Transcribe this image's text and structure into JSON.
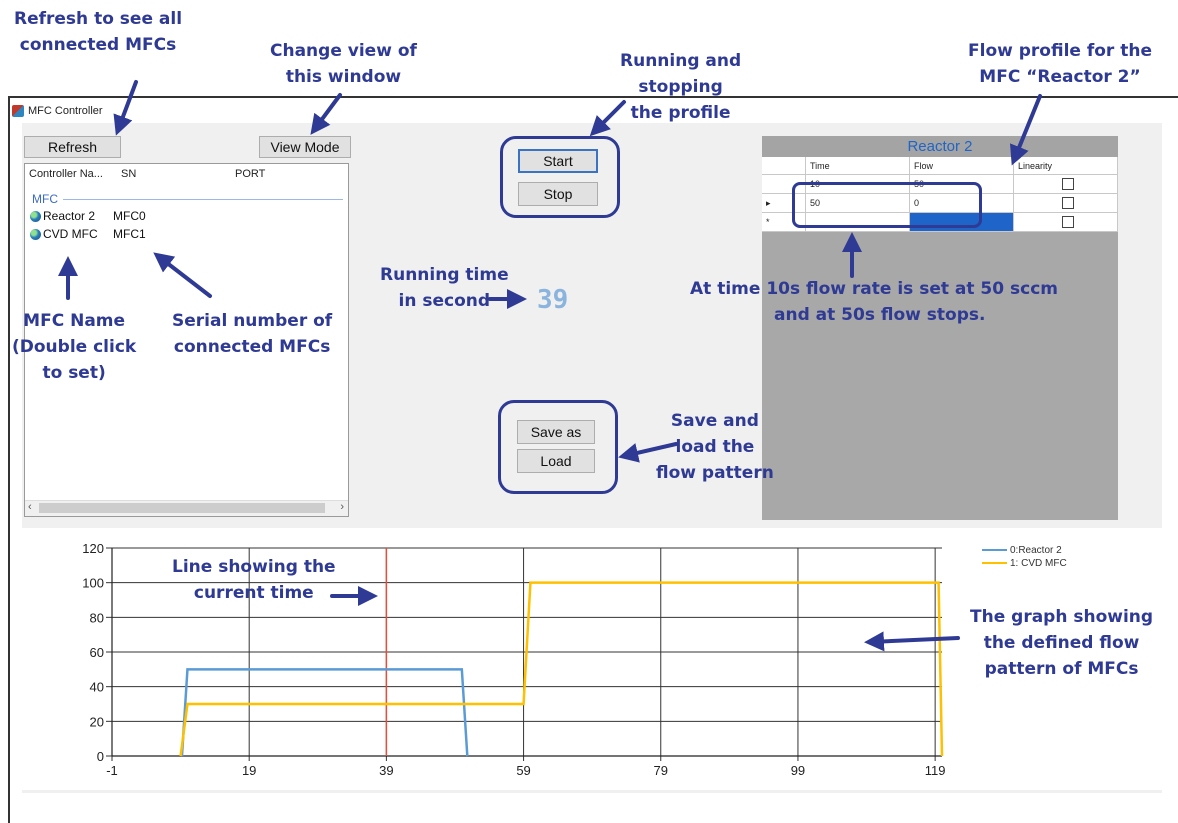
{
  "window": {
    "title": "MFC Controller"
  },
  "toolbar": {
    "refresh_label": "Refresh",
    "view_mode_label": "View Mode"
  },
  "mfc_list": {
    "columns": [
      "Controller Na...",
      "SN",
      "PORT"
    ],
    "group_label": "MFC",
    "rows": [
      {
        "name": "Reactor 2",
        "sn": "MFC0",
        "icon": "globe-icon"
      },
      {
        "name": "CVD MFC",
        "sn": "MFC1",
        "icon": "globe-icon"
      }
    ],
    "scroll_left": "‹",
    "scroll_right": "›"
  },
  "profile_controls": {
    "start_label": "Start",
    "stop_label": "Stop"
  },
  "file_controls": {
    "save_as_label": "Save as",
    "load_label": "Load"
  },
  "running_time": {
    "value": "39"
  },
  "profile_grid": {
    "title": "Reactor 2",
    "columns": [
      "Time",
      "Flow",
      "Linearity"
    ],
    "rows": [
      {
        "indicator": "",
        "time": "10",
        "flow": "50",
        "linearity": false
      },
      {
        "indicator": "▸",
        "time": "50",
        "flow": "0",
        "linearity": false
      },
      {
        "indicator": "*",
        "time": "",
        "flow": "",
        "linearity": false
      }
    ]
  },
  "annotations": {
    "refresh_note": [
      "Refresh to see all",
      "connected MFCs"
    ],
    "view_note": [
      "Change view of",
      "this window"
    ],
    "run_note": [
      "Running and",
      "stopping",
      "the profile"
    ],
    "profile_note": [
      "Flow profile for the",
      "MFC “Reactor 2”"
    ],
    "running_time_note": [
      "Running time",
      "in second"
    ],
    "time_note": [
      "At time 10s flow rate is set at 50 sccm",
      "and at 50s flow stops."
    ],
    "name_note": [
      "MFC Name",
      "(Double click",
      "to set)"
    ],
    "serial_note": [
      "Serial  number of",
      "connected MFCs"
    ],
    "save_note": [
      "Save and",
      "load the",
      "flow pattern"
    ],
    "line_note": [
      "Line showing the",
      "current time"
    ],
    "graph_note": [
      "The graph showing",
      "the defined flow",
      "pattern of MFCs"
    ]
  },
  "colors": {
    "annotation": "#2e3a93",
    "reactor2_line": "#5b9bd5",
    "cvd_line": "#ffc000",
    "current_time_line": "#e74c3c",
    "grid_header": "#1f64c8"
  },
  "chart_data": {
    "type": "line",
    "x_ticks": [
      "-1",
      "19",
      "39",
      "59",
      "79",
      "99",
      "119"
    ],
    "y_ticks": [
      "0",
      "20",
      "40",
      "60",
      "80",
      "100",
      "120"
    ],
    "xlim": [
      -1,
      120
    ],
    "ylim": [
      0,
      120
    ],
    "grid": true,
    "legend_position": "top-right",
    "current_time": 39,
    "series": [
      {
        "name": "0:Reactor 2",
        "color": "#5b9bd5",
        "points": [
          [
            9.2,
            0
          ],
          [
            10,
            50
          ],
          [
            50,
            50
          ],
          [
            50.8,
            0
          ]
        ]
      },
      {
        "name": "1: CVD MFC",
        "color": "#ffc000",
        "points": [
          [
            9,
            0
          ],
          [
            10,
            30
          ],
          [
            59,
            30
          ],
          [
            60,
            100
          ],
          [
            119.5,
            100
          ],
          [
            120,
            0
          ]
        ]
      }
    ]
  }
}
